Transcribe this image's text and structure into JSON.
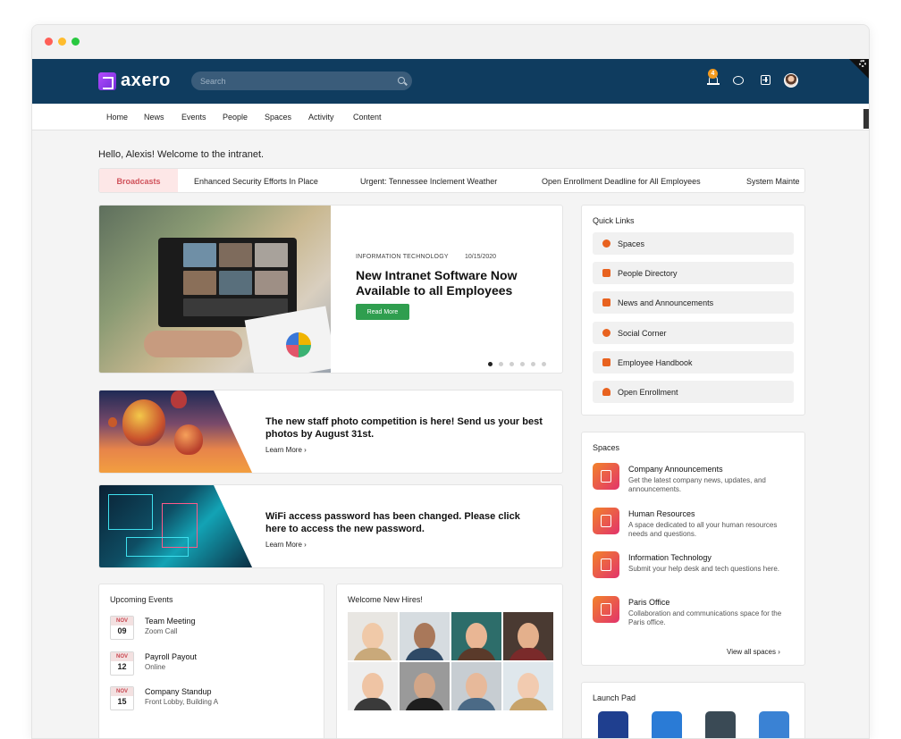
{
  "app": {
    "brand": "axero",
    "colors": {
      "topbar": "#0f3c5f",
      "accent": "#2f9e4f",
      "broadcast": "#d0515a",
      "icon": "#e8621f"
    }
  },
  "topbar": {
    "search_placeholder": "Search",
    "notifications_count": "4",
    "icons": [
      "bell-icon",
      "chat-icon",
      "plus-icon",
      "avatar"
    ]
  },
  "nav": {
    "items": [
      "Home",
      "News",
      "Events",
      "People",
      "Spaces",
      "Activity",
      "Content"
    ]
  },
  "greeting": "Hello, Alexis! Welcome to the intranet.",
  "broadcast": {
    "label": "Broadcasts",
    "items": [
      "Enhanced Security Efforts In Place",
      "Urgent: Tennessee Inclement Weather",
      "Open Enrollment Deadline for All Employees",
      "System Mainte"
    ]
  },
  "hero": {
    "category": "INFORMATION TECHNOLOGY",
    "date": "10/15/2020",
    "title": "New Intranet Software Now Available to all Employees",
    "button": "Read More",
    "slides": 6,
    "active_slide": 1
  },
  "promos": [
    {
      "title": "The new staff photo competition is here! Send us your best photos by August 31st.",
      "link": "Learn More ›"
    },
    {
      "title": "WiFi access password has been changed. Please click here to access the new password.",
      "link": "Learn More ›"
    }
  ],
  "quick_links": {
    "title": "Quick Links",
    "items": [
      {
        "label": "Spaces",
        "icon": "globe-icon"
      },
      {
        "label": "People Directory",
        "icon": "person-icon"
      },
      {
        "label": "News and Announcements",
        "icon": "megaphone-icon"
      },
      {
        "label": "Social Corner",
        "icon": "chat-icon"
      },
      {
        "label": "Employee Handbook",
        "icon": "book-icon"
      },
      {
        "label": "Open Enrollment",
        "icon": "bell-icon"
      }
    ]
  },
  "spaces": {
    "title": "Spaces",
    "items": [
      {
        "name": "Company Announcements",
        "desc": "Get the latest company news, updates, and announcements.",
        "icon": "microphone-icon"
      },
      {
        "name": "Human Resources",
        "desc": "A space dedicated to all your human resources needs and questions.",
        "icon": "org-chart-icon"
      },
      {
        "name": "Information Technology",
        "desc": "Submit your help desk and tech questions here.",
        "icon": "computer-icon"
      },
      {
        "name": "Paris Office",
        "desc": "Collaboration and communications space for the Paris office.",
        "icon": "document-icon"
      }
    ],
    "view_all": "View all spaces ›"
  },
  "launch_pad": {
    "title": "Launch Pad"
  },
  "events": {
    "title": "Upcoming Events",
    "items": [
      {
        "month": "NOV",
        "day": "09",
        "name": "Team Meeting",
        "location": "Zoom Call"
      },
      {
        "month": "NOV",
        "day": "12",
        "name": "Payroll Payout",
        "location": "Online"
      },
      {
        "month": "NOV",
        "day": "15",
        "name": "Company Standup",
        "location": "Front Lobby, Building A"
      }
    ]
  },
  "new_hires": {
    "title": "Welcome New Hires!"
  }
}
